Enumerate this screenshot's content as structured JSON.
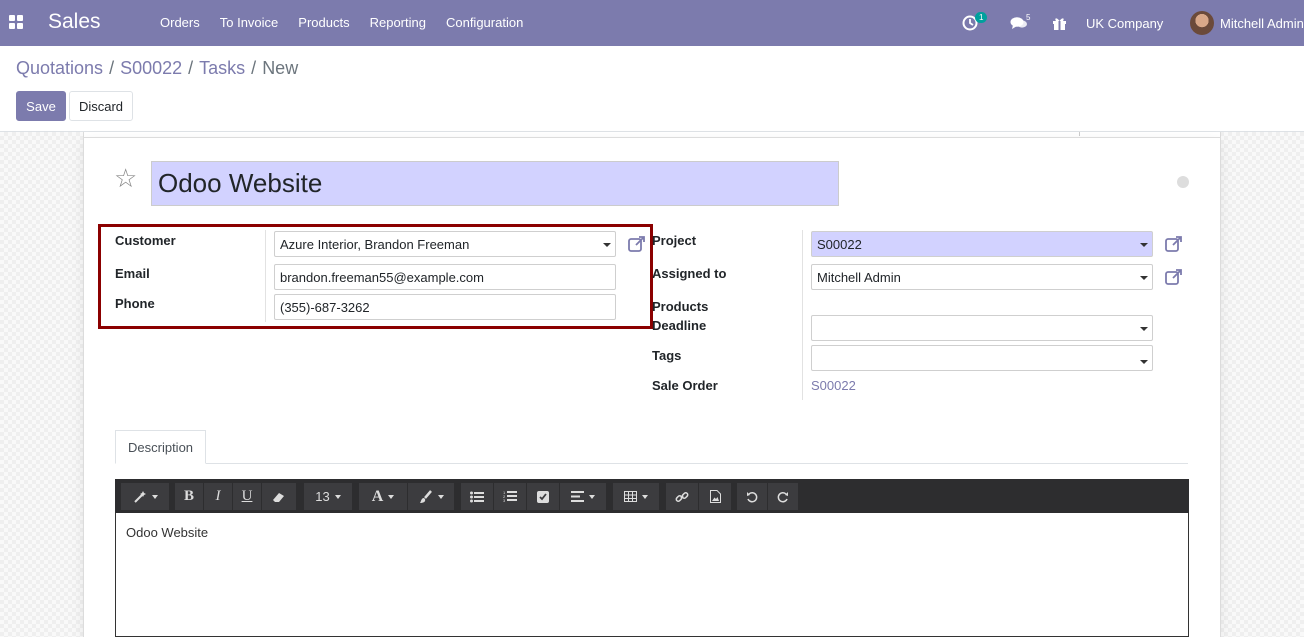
{
  "navbar": {
    "app_name": "Sales",
    "menu": [
      "Orders",
      "To Invoice",
      "Products",
      "Reporting",
      "Configuration"
    ],
    "activity_count": "1",
    "messages_count": "5",
    "company": "UK Company",
    "user": "Mitchell Admin",
    "color": "#7c7bad"
  },
  "breadcrumb": [
    "Quotations",
    "S00022",
    "Tasks",
    "New"
  ],
  "actions": {
    "save": "Save",
    "discard": "Discard"
  },
  "task": {
    "title": "Odoo Website",
    "customer_label": "Customer",
    "customer_value": "Azure Interior, Brandon Freeman",
    "email_label": "Email",
    "email_value": "brandon.freeman55@example.com",
    "phone_label": "Phone",
    "phone_value": "(355)-687-3262",
    "project_label": "Project",
    "project_value": "S00022",
    "assigned_label": "Assigned to",
    "assigned_value": "Mitchell Admin",
    "products_label": "Products",
    "deadline_label": "Deadline",
    "deadline_value": "",
    "tags_label": "Tags",
    "tags_value": "",
    "sale_order_label": "Sale Order",
    "sale_order_value": "S00022"
  },
  "notebook": {
    "tab_description": "Description"
  },
  "editor": {
    "font_size": "13",
    "content": "Odoo Website"
  }
}
